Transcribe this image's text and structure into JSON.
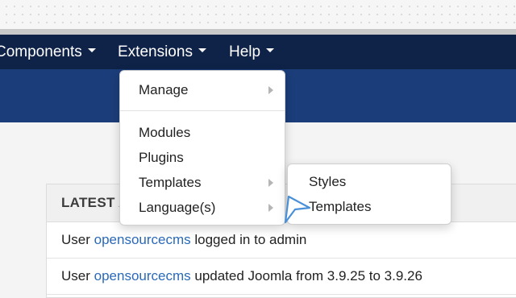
{
  "navbar": {
    "items": [
      {
        "label": "Components"
      },
      {
        "label": "Extensions"
      },
      {
        "label": "Help"
      }
    ]
  },
  "extensions_menu": {
    "manage": "Manage",
    "modules": "Modules",
    "plugins": "Plugins",
    "templates": "Templates",
    "languages": "Language(s)"
  },
  "templates_submenu": {
    "styles": "Styles",
    "templates": "Templates"
  },
  "activity_panel": {
    "title": "LATEST A",
    "rows": [
      {
        "prefix": "User ",
        "user": "opensourcecms",
        "suffix": " logged in to admin"
      },
      {
        "prefix": "User ",
        "user": "opensourcecms",
        "suffix": " updated Joomla from 3.9.25 to 3.9.26"
      }
    ]
  },
  "colors": {
    "navbar": "#0f2248",
    "header_band": "#1b3d79",
    "link": "#2a69b8",
    "cursor": "#4a90d9"
  },
  "icons": {
    "nav_caret": "caret-down-icon",
    "submenu_arrow": "caret-right-icon",
    "pointer": "mouse-pointer-icon"
  }
}
